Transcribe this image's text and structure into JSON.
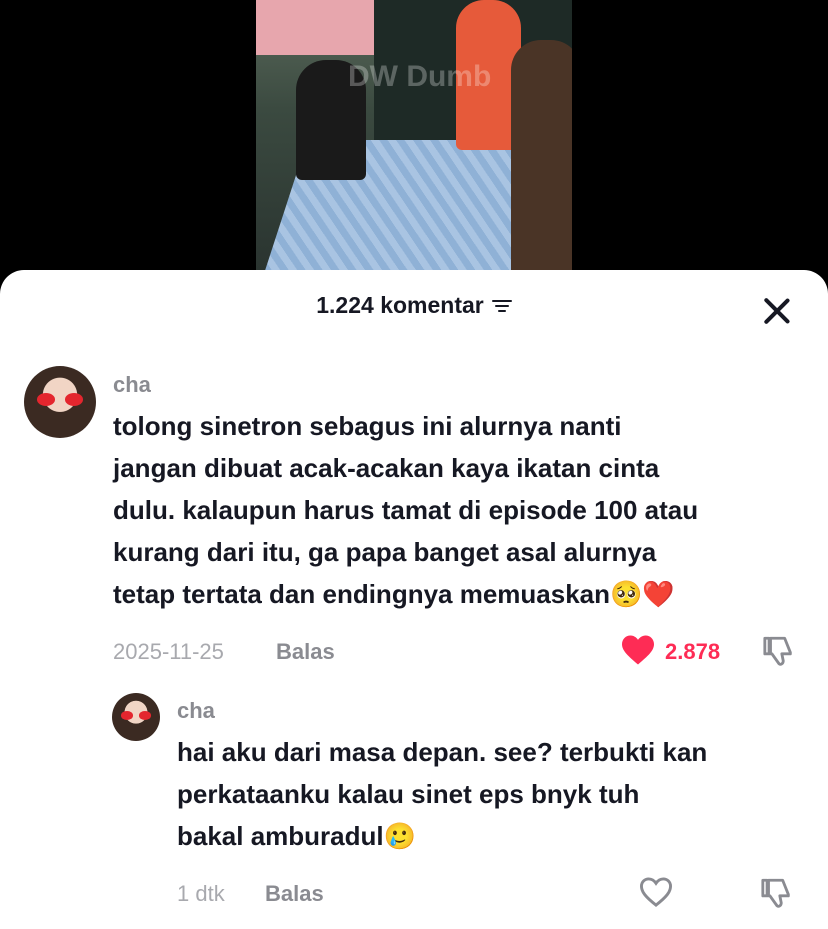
{
  "video": {
    "watermark": "DW Dumb"
  },
  "header": {
    "title": "1.224 komentar",
    "filter_icon": "filter-icon",
    "close_icon": "close-icon"
  },
  "comments": [
    {
      "username": "cha",
      "lines": [
        "tolong sinetron sebagus ini alurnya nanti",
        "jangan dibuat acak-acakan kaya ikatan cinta",
        "dulu. kalaupun harus tamat di episode 100 atau",
        "kurang dari itu, ga papa banget asal alurnya",
        "tetap tertata dan endingnya memuaskan"
      ],
      "trailing_emoji": "🥺❤️",
      "date": "2025-11-25",
      "reply_label": "Balas",
      "likes": "2.878",
      "liked": true
    },
    {
      "username": "cha",
      "lines": [
        "hai aku dari masa depan. see? terbukti kan",
        "perkataanku kalau sinet eps bnyk tuh",
        "bakal amburadul"
      ],
      "trailing_emoji": "🥲",
      "date": "1 dtk",
      "reply_label": "Balas",
      "liked": false
    }
  ],
  "colors": {
    "accent": "#fe2c55",
    "text": "#161823",
    "muted": "#8a8b91"
  }
}
